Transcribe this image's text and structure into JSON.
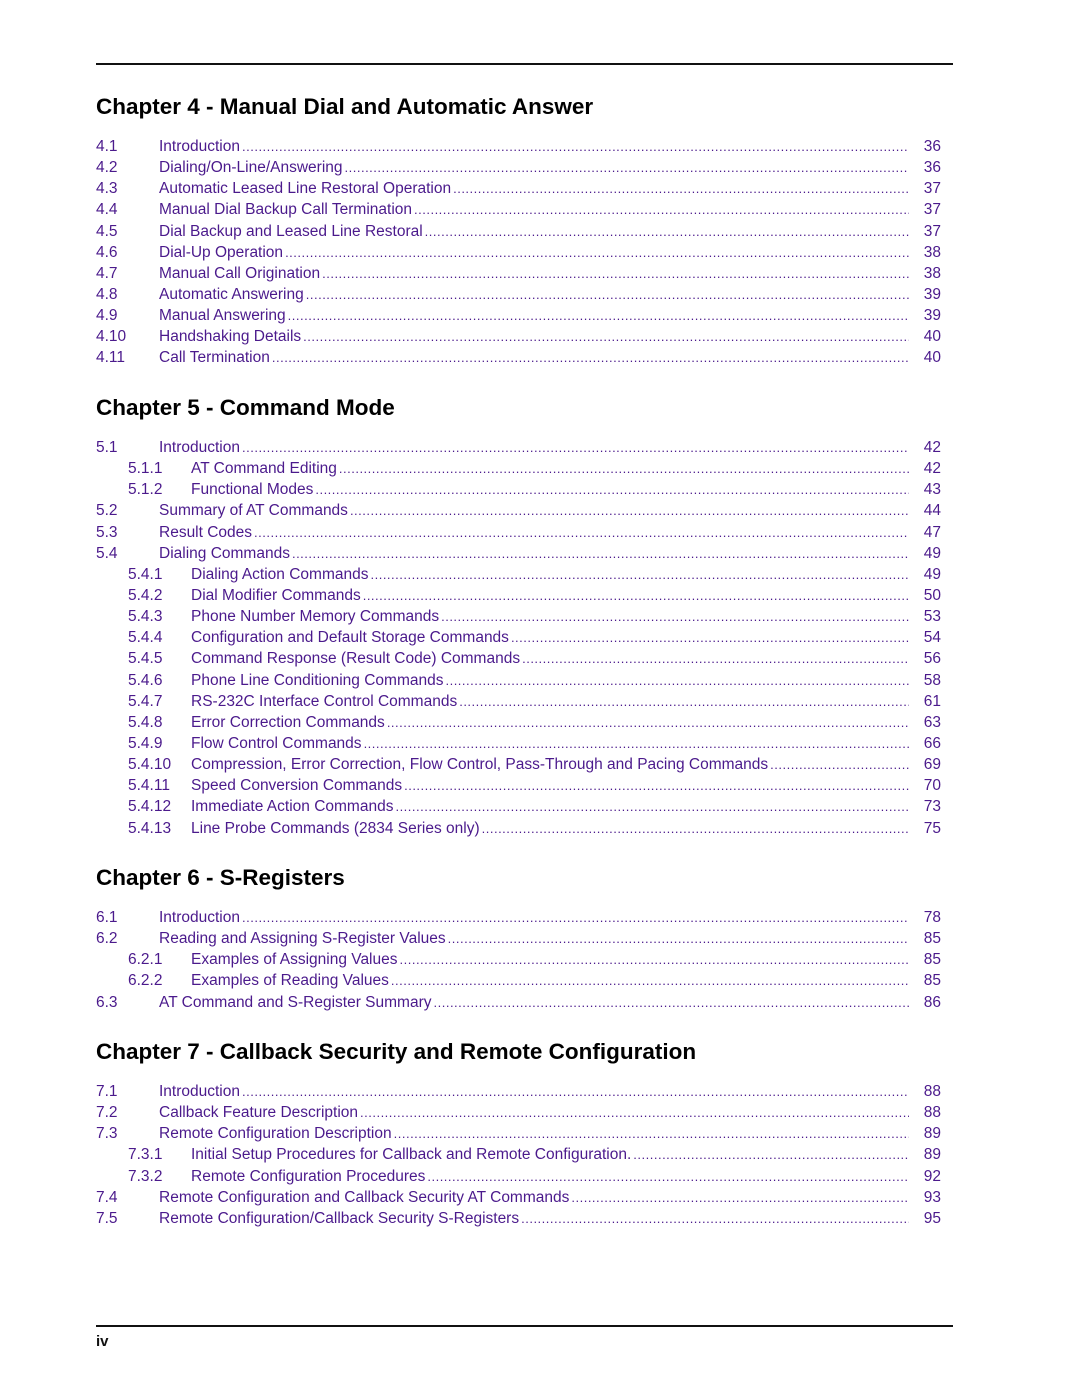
{
  "footer": {
    "page_number": "iv"
  },
  "chapters": [
    {
      "title": "Chapter 4 - Manual Dial and Automatic Answer",
      "entries": [
        {
          "num": "4.1",
          "title": "Introduction",
          "page": "36",
          "level": 1
        },
        {
          "num": "4.2",
          "title": "Dialing/On-Line/Answering",
          "page": "36",
          "level": 1
        },
        {
          "num": "4.3",
          "title": "Automatic Leased Line Restoral Operation",
          "page": "37",
          "level": 1
        },
        {
          "num": "4.4",
          "title": "Manual Dial Backup Call Termination",
          "page": "37",
          "level": 1
        },
        {
          "num": "4.5",
          "title": "Dial Backup and Leased Line Restoral",
          "page": "37",
          "level": 1
        },
        {
          "num": "4.6",
          "title": "Dial-Up Operation",
          "page": "38",
          "level": 1
        },
        {
          "num": "4.7",
          "title": "Manual Call Origination",
          "page": "38",
          "level": 1
        },
        {
          "num": "4.8",
          "title": "Automatic Answering",
          "page": "39",
          "level": 1
        },
        {
          "num": "4.9",
          "title": "Manual Answering",
          "page": "39",
          "level": 1
        },
        {
          "num": "4.10",
          "title": "Handshaking Details",
          "page": "40",
          "level": 1
        },
        {
          "num": "4.11",
          "title": "Call Termination",
          "page": "40",
          "level": 1
        }
      ]
    },
    {
      "title": "Chapter 5 - Command Mode",
      "entries": [
        {
          "num": "5.1",
          "title": "Introduction",
          "page": "42",
          "level": 1
        },
        {
          "num": "5.1.1",
          "title": "AT Command Editing",
          "page": "42",
          "level": 2
        },
        {
          "num": "5.1.2",
          "title": "Functional Modes",
          "page": "43",
          "level": 2
        },
        {
          "num": "5.2",
          "title": "Summary of AT Commands",
          "page": "44",
          "level": 1
        },
        {
          "num": "5.3",
          "title": "Result Codes",
          "page": "47",
          "level": 1
        },
        {
          "num": "5.4",
          "title": "Dialing Commands",
          "page": "49",
          "level": 1
        },
        {
          "num": "5.4.1",
          "title": "Dialing Action Commands",
          "page": "49",
          "level": 2
        },
        {
          "num": "5.4.2",
          "title": "Dial Modifier Commands",
          "page": "50",
          "level": 2
        },
        {
          "num": "5.4.3",
          "title": "Phone Number Memory Commands",
          "page": "53",
          "level": 2
        },
        {
          "num": "5.4.4",
          "title": "Configuration and Default Storage Commands",
          "page": "54",
          "level": 2
        },
        {
          "num": "5.4.5",
          "title": "Command Response (Result Code) Commands",
          "page": "56",
          "level": 2
        },
        {
          "num": "5.4.6",
          "title": "Phone Line Conditioning Commands",
          "page": "58",
          "level": 2
        },
        {
          "num": "5.4.7",
          "title": "RS-232C Interface Control Commands",
          "page": "61",
          "level": 2
        },
        {
          "num": "5.4.8",
          "title": "Error Correction Commands",
          "page": "63",
          "level": 2
        },
        {
          "num": "5.4.9",
          "title": "Flow Control Commands",
          "page": "66",
          "level": 2
        },
        {
          "num": "5.4.10",
          "title": "Compression, Error Correction, Flow Control, Pass-Through and Pacing Commands",
          "page": "69",
          "level": 2
        },
        {
          "num": "5.4.11",
          "title": "Speed Conversion Commands",
          "page": "70",
          "level": 2
        },
        {
          "num": "5.4.12",
          "title": "Immediate Action Commands",
          "page": "73",
          "level": 2
        },
        {
          "num": "5.4.13",
          "title": "Line Probe Commands (2834 Series only)",
          "page": "75",
          "level": 2
        }
      ]
    },
    {
      "title": "Chapter 6 - S-Registers",
      "entries": [
        {
          "num": "6.1",
          "title": "Introduction",
          "page": "78",
          "level": 1
        },
        {
          "num": "6.2",
          "title": "Reading and Assigning S-Register Values",
          "page": "85",
          "level": 1
        },
        {
          "num": "6.2.1",
          "title": "Examples of Assigning Values",
          "page": "85",
          "level": 2
        },
        {
          "num": "6.2.2",
          "title": "Examples of Reading Values",
          "page": "85",
          "level": 2
        },
        {
          "num": "6.3",
          "title": "AT Command and S-Register Summary",
          "page": "86",
          "level": 1
        }
      ]
    },
    {
      "title": "Chapter 7 - Callback Security and Remote Configuration",
      "entries": [
        {
          "num": "7.1",
          "title": "Introduction",
          "page": "88",
          "level": 1
        },
        {
          "num": "7.2",
          "title": "Callback Feature Description",
          "page": "88",
          "level": 1
        },
        {
          "num": "7.3",
          "title": "Remote Configuration Description",
          "page": "89",
          "level": 1
        },
        {
          "num": "7.3.1",
          "title": "Initial Setup Procedures for Callback and Remote Configuration.",
          "page": "89",
          "level": 2
        },
        {
          "num": "7.3.2",
          "title": "Remote Configuration Procedures",
          "page": "92",
          "level": 2
        },
        {
          "num": "7.4",
          "title": "Remote Configuration and Callback Security AT Commands",
          "page": "93",
          "level": 1
        },
        {
          "num": "7.5",
          "title": "Remote Configuration/Callback Security S-Registers",
          "page": "95",
          "level": 1
        }
      ]
    }
  ]
}
